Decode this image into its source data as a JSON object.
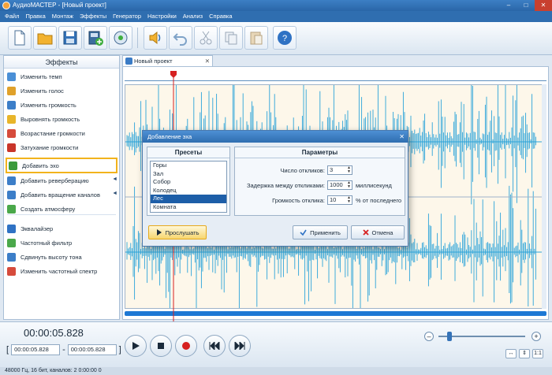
{
  "window": {
    "title": "АудиоМАСТЕР - [Новый проект]",
    "controls": [
      "–",
      "□",
      "✕"
    ]
  },
  "menu": [
    "Файл",
    "Правка",
    "Монтаж",
    "Эффекты",
    "Генератор",
    "Настройки",
    "Анализ",
    "Справка"
  ],
  "toolbar": {
    "buttons": [
      "new-file-icon",
      "open-folder-icon",
      "save-disk-icon",
      "add-video-icon",
      "record-disc-icon",
      "audio-speaker-icon",
      "undo-icon",
      "cut-icon",
      "copy-icon",
      "paste-icon",
      "help-icon"
    ]
  },
  "effects_panel": {
    "title": "Эффекты",
    "items": [
      {
        "label": "Изменить темп",
        "color": "#4a8fd6"
      },
      {
        "label": "Изменить голос",
        "color": "#e0a12a"
      },
      {
        "label": "Изменить громкость",
        "color": "#3c7ec8"
      },
      {
        "label": "Выровнять громкость",
        "color": "#e8b52a"
      },
      {
        "label": "Возрастание громкости",
        "color": "#d64b3c"
      },
      {
        "label": "Затухание громкости",
        "color": "#c9352a"
      },
      {
        "label": "Добавить эхо",
        "color": "#3c9a3c"
      },
      {
        "label": "Добавить реверберацию",
        "color": "#3c7ec8"
      },
      {
        "label": "Добавить вращение каналов",
        "color": "#3c7ec8"
      },
      {
        "label": "Создать атмосферу",
        "color": "#4aa84a"
      },
      {
        "label": "Эквалайзер",
        "color": "#2f72c4"
      },
      {
        "label": "Частотный фильтр",
        "color": "#4aa84a"
      },
      {
        "label": "Сдвинуть высоту тона",
        "color": "#3c7ec8"
      },
      {
        "label": "Изменить частотный спектр",
        "color": "#d64b3c"
      }
    ],
    "highlighted": "Добавить эхо"
  },
  "document_tab": {
    "label": "Новый проект",
    "close": "✕"
  },
  "dialog": {
    "title": "Добавление эха",
    "close": "✕",
    "presets_header": "Пресеты",
    "presets": [
      "Горы",
      "Зал",
      "Собор",
      "Колодец",
      "Лес",
      "Комната"
    ],
    "selected_preset": "Лес",
    "params_header": "Параметры",
    "params": {
      "count_label": "Число откликов:",
      "count_value": "3",
      "delay_label": "Задержка между откликами:",
      "delay_value": "1000",
      "delay_unit": "миллисекунд",
      "volume_label": "Громкость отклика:",
      "volume_value": "10",
      "volume_unit": "% от последнего"
    },
    "listen_label": "Прослушать",
    "apply_label": "Применить",
    "cancel_label": "Отмена"
  },
  "transport": {
    "current_time": "00:00:05.828",
    "range_start": "00:00:05.828",
    "range_end": "00:00:05.828",
    "range_dash": "-",
    "bracket_open": "[",
    "bracket_close": "]"
  },
  "zoom": {
    "minus": "–",
    "plus": "+",
    "level": 0.1
  },
  "status": "48000 Гц, 16 бит, каналов: 2    0:00:00 0",
  "colors": {
    "accent": "#1d78d4",
    "waveform": "#2ba3d9",
    "highlight": "#f2b31c",
    "cursor": "#d62020"
  }
}
